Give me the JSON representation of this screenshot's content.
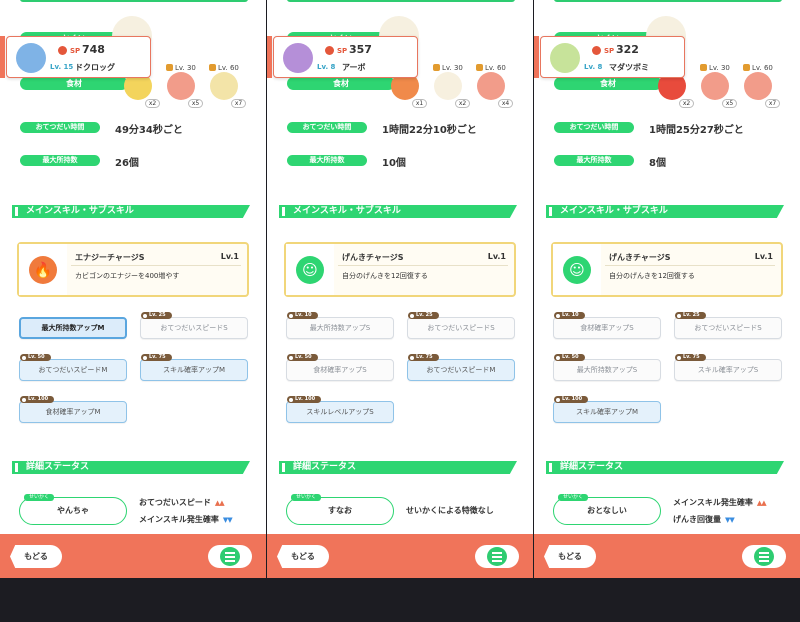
{
  "labels": {
    "main_label_top": "とくい",
    "ingredient_label": "食材",
    "help_time": "おてつだい時間",
    "max_carry": "最大所持数",
    "skill_section": "メインスキル・サブスキル",
    "detail_section": "詳細ステータス",
    "nature_tag": "せいかく",
    "back": "もどる"
  },
  "icons": [
    "sp-icon",
    "lock-icon",
    "menu-icon",
    "flame-icon",
    "smile-icon",
    "arrow-up-icon",
    "arrow-down-icon"
  ],
  "colors": {
    "green": "#2ed572",
    "orange": "#f0745a",
    "yellow": "#f1d67a",
    "blue": "#5aa6df"
  },
  "panels": [
    {
      "pokemon": {
        "sp_label": "SP",
        "sp": "748",
        "lv": "Lv. 15",
        "name": "ドクロッグ"
      },
      "ingredients": [
        {
          "lv": "",
          "count": "x2",
          "color": "#f3d45c"
        },
        {
          "lv": "Lv. 30",
          "count": "x5",
          "color": "#f29c8a"
        },
        {
          "lv": "Lv. 60",
          "count": "x7",
          "color": "#f3e4a8"
        }
      ],
      "help_time": "49分34秒ごと",
      "max_carry": "26個",
      "skill": {
        "name": "エナジーチャージS",
        "lv": "Lv.1",
        "desc": "カビゴンのエナジーを400増やす",
        "icon_color": "#f07a3c",
        "icon": "flame-icon"
      },
      "subskills": [
        {
          "tag": "",
          "label": "最大所持数アップM",
          "state": "selected"
        },
        {
          "tag": "Lv. 25",
          "label": "おてつだいスピードS",
          "state": ""
        },
        {
          "tag": "Lv. 50",
          "label": "おてつだいスピードM",
          "state": "active"
        },
        {
          "tag": "Lv. 75",
          "label": "スキル確率アップM",
          "state": "active"
        },
        {
          "tag": "Lv. 100",
          "label": "食材確率アップM",
          "state": "active"
        }
      ],
      "nature": {
        "name": "やんちゃ",
        "up": "おてつだいスピード",
        "down": "メインスキル発生確率",
        "neutral": ""
      }
    },
    {
      "pokemon": {
        "sp_label": "SP",
        "sp": "357",
        "lv": "Lv. 8",
        "name": "アーボ"
      },
      "ingredients": [
        {
          "lv": "",
          "count": "x1",
          "color": "#f08a4a"
        },
        {
          "lv": "Lv. 30",
          "count": "x2",
          "color": "#f7f0df"
        },
        {
          "lv": "Lv. 60",
          "count": "x4",
          "color": "#f29c8a"
        }
      ],
      "help_time": "1時間22分10秒ごと",
      "max_carry": "10個",
      "skill": {
        "name": "げんきチャージS",
        "lv": "Lv.1",
        "desc": "自分のげんきを12回復する",
        "icon_color": "#2ed572",
        "icon": "smile-icon"
      },
      "subskills": [
        {
          "tag": "Lv. 10",
          "label": "最大所持数アップS",
          "state": ""
        },
        {
          "tag": "Lv. 25",
          "label": "おてつだいスピードS",
          "state": ""
        },
        {
          "tag": "Lv. 50",
          "label": "食材確率アップS",
          "state": ""
        },
        {
          "tag": "Lv. 75",
          "label": "おてつだいスピードM",
          "state": "active"
        },
        {
          "tag": "Lv. 100",
          "label": "スキルレベルアップS",
          "state": "active"
        }
      ],
      "nature": {
        "name": "すなお",
        "up": "",
        "down": "",
        "neutral": "せいかくによる特徴なし"
      }
    },
    {
      "pokemon": {
        "sp_label": "SP",
        "sp": "322",
        "lv": "Lv. 8",
        "name": "マダツボミ"
      },
      "ingredients": [
        {
          "lv": "",
          "count": "x2",
          "color": "#e84b3c"
        },
        {
          "lv": "Lv. 30",
          "count": "x5",
          "color": "#f29c8a"
        },
        {
          "lv": "Lv. 60",
          "count": "x7",
          "color": "#f29c8a"
        }
      ],
      "help_time": "1時間25分27秒ごと",
      "max_carry": "8個",
      "skill": {
        "name": "げんきチャージS",
        "lv": "Lv.1",
        "desc": "自分のげんきを12回復する",
        "icon_color": "#2ed572",
        "icon": "smile-icon"
      },
      "subskills": [
        {
          "tag": "Lv. 10",
          "label": "食材確率アップS",
          "state": ""
        },
        {
          "tag": "Lv. 25",
          "label": "おてつだいスピードS",
          "state": ""
        },
        {
          "tag": "Lv. 50",
          "label": "最大所持数アップS",
          "state": ""
        },
        {
          "tag": "Lv. 75",
          "label": "スキル確率アップS",
          "state": ""
        },
        {
          "tag": "Lv. 100",
          "label": "スキル確率アップM",
          "state": "active"
        }
      ],
      "nature": {
        "name": "おとなしい",
        "up": "メインスキル発生確率",
        "down": "げんき回復量",
        "neutral": ""
      }
    }
  ]
}
